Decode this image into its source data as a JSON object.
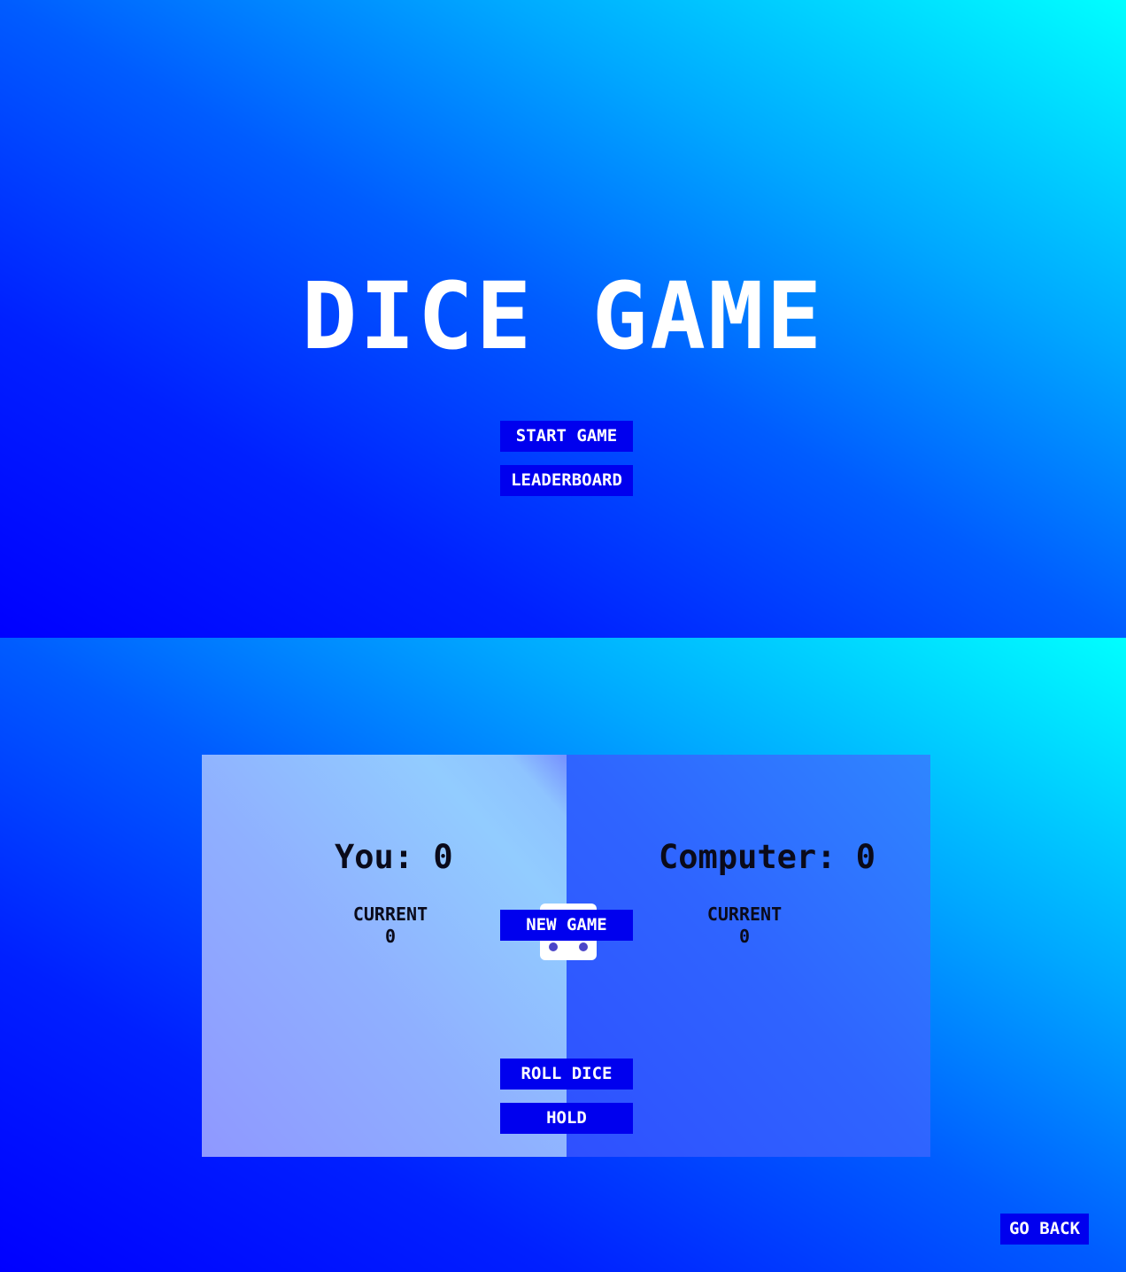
{
  "menu": {
    "title": "DICE GAME",
    "start_label": "START GAME",
    "leaderboard_label": "LEADERBOARD"
  },
  "game": {
    "new_game_label": "NEW GAME",
    "player": {
      "score_text": "You: 0",
      "current_label": "CURRENT",
      "current_value": "0"
    },
    "computer": {
      "score_text": "Computer: 0",
      "current_label": "CURRENT",
      "current_value": "0"
    },
    "die_value": 6,
    "roll_label": "ROLL DICE",
    "hold_label": "HOLD",
    "go_back_label": "GO BACK"
  },
  "colors": {
    "button": "#0000ee",
    "pip": "#4b45c8",
    "gradient_start": "#0000ff",
    "gradient_end": "#00ffff"
  }
}
